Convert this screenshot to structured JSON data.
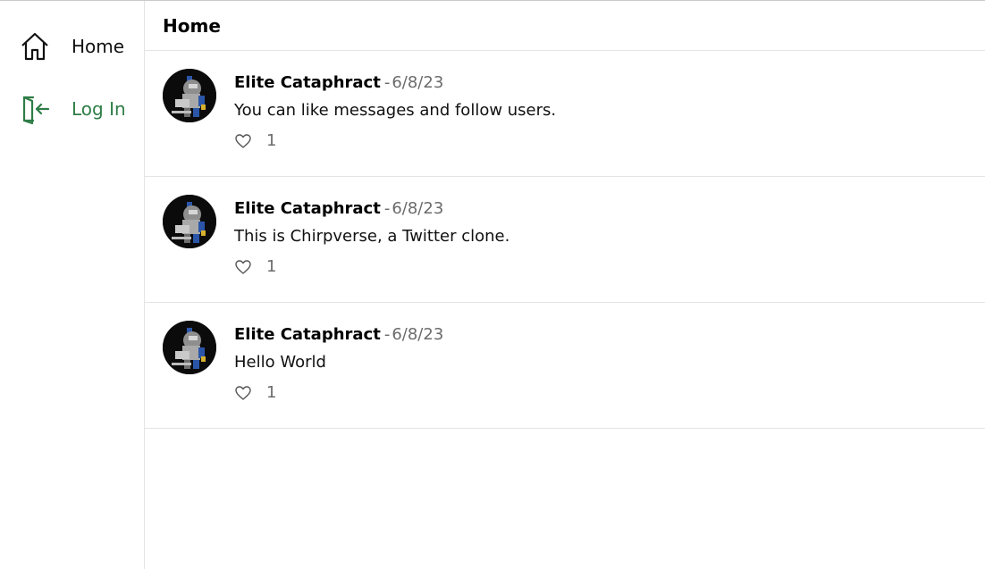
{
  "sidebar": {
    "items": [
      {
        "label": "Home",
        "icon": "home-icon",
        "color": "#111111"
      },
      {
        "label": "Log In",
        "icon": "login-icon",
        "color": "#2e7d46"
      }
    ]
  },
  "header": {
    "title": "Home"
  },
  "posts": [
    {
      "author": "Elite Cataphract",
      "separator": "-",
      "date": "6/8/23",
      "text": "You can like messages and follow users.",
      "likes": "1"
    },
    {
      "author": "Elite Cataphract",
      "separator": "-",
      "date": "6/8/23",
      "text": "This is Chirpverse, a Twitter clone.",
      "likes": "1"
    },
    {
      "author": "Elite Cataphract",
      "separator": "-",
      "date": "6/8/23",
      "text": "Hello World",
      "likes": "1"
    }
  ]
}
